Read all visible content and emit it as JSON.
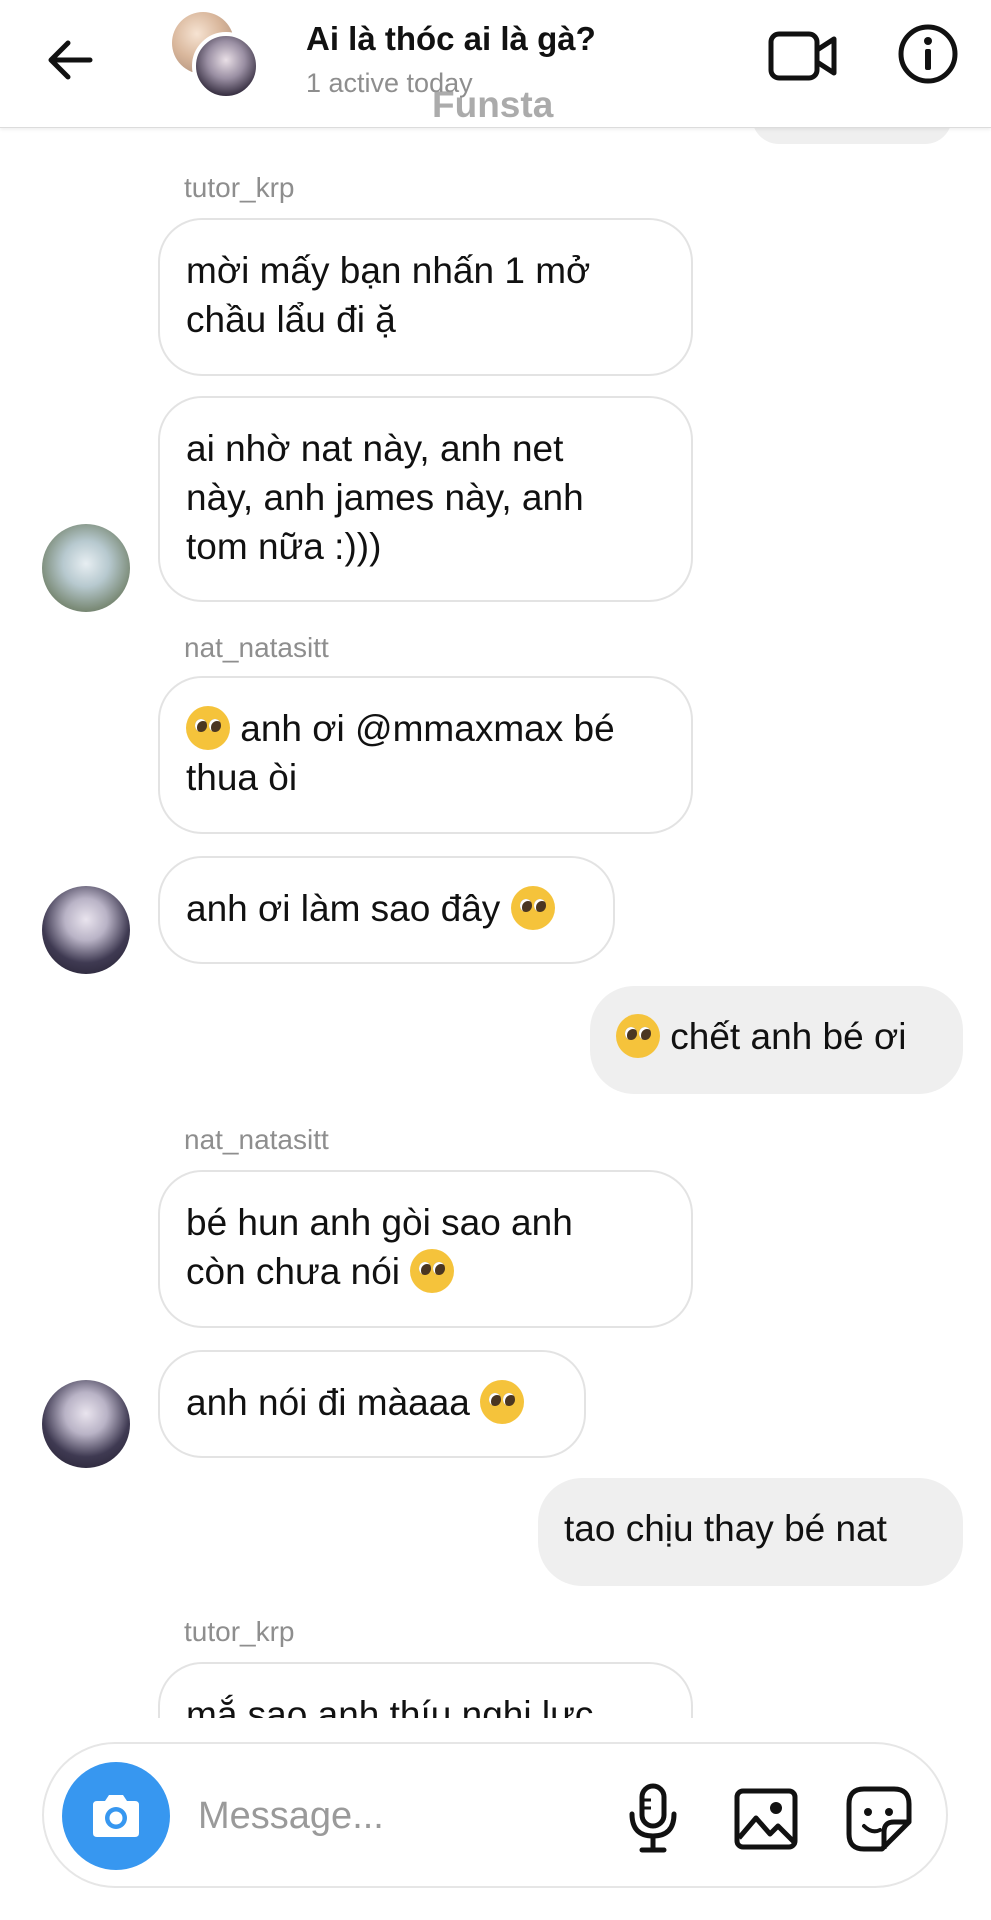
{
  "header": {
    "title": "Ai là thóc ai là gà?",
    "status": "1 active today",
    "watermark": "Funsta"
  },
  "messages": [
    {
      "sender": "tutor_krp"
    },
    {
      "text": "mời mấy bạn nhấn 1 mở\nchầu lẩu đi ặ"
    },
    {
      "text": "ai nhờ nat này, anh net\nnày, anh james này, anh\ntom nữa :)))"
    },
    {
      "sender": "nat_natasitt"
    },
    {
      "text": " anh ơi @mmaxmax bé\nthua òi",
      "emoji": "pleading-face"
    },
    {
      "text": "anh ơi làm sao đây ",
      "emoji": "pleading-face"
    },
    {
      "text": " chết anh bé ơi",
      "emoji": "smiling-face-with-tear"
    },
    {
      "sender": "nat_natasitt"
    },
    {
      "text": "bé hun anh gòi sao anh\ncòn chưa nói ",
      "emoji": "pleading-face"
    },
    {
      "text": "anh nói đi màaaa ",
      "emoji": "pleading-face"
    },
    {
      "text": "tao chịu thay bé nat"
    },
    {
      "sender": "tutor_krp"
    },
    {
      "text": "mắ sao anh thíu nghị lực"
    }
  ],
  "composer": {
    "placeholder": "Message..."
  },
  "icons": {
    "back": "arrow-left-icon",
    "video": "video-camera-icon",
    "info": "info-icon",
    "camera": "camera-icon",
    "mic": "microphone-icon",
    "gallery": "image-icon",
    "sticker": "sticker-icon"
  },
  "colors": {
    "accent": "#3797f0",
    "outgoing_bubble": "#efefef",
    "incoming_border": "#e3e3e3",
    "meta_text": "#8e8e8e"
  }
}
